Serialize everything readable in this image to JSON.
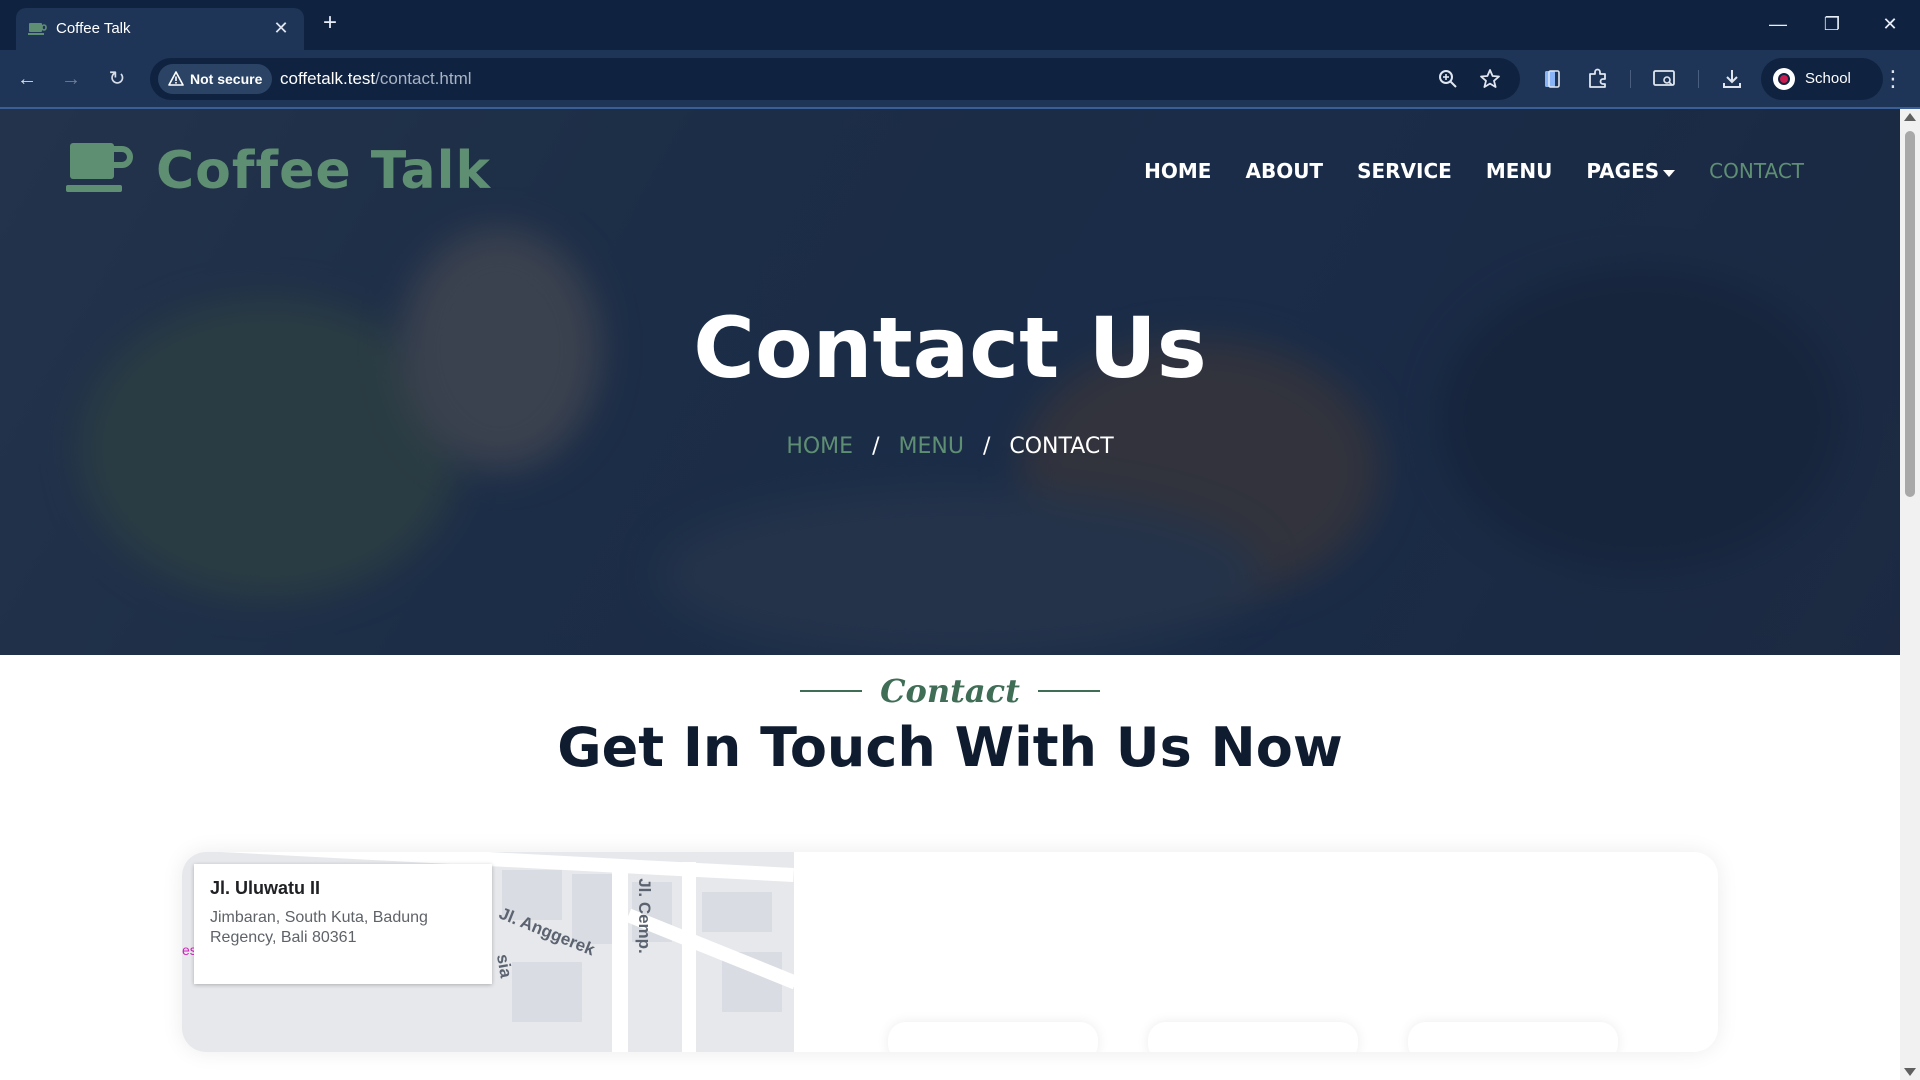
{
  "browser": {
    "tab_title": "Coffee Talk",
    "security_label": "Not secure",
    "url_host": "coffetalk.test",
    "url_path": "/contact.html",
    "profile_label": "School"
  },
  "site": {
    "brand_name": "Coffee Talk",
    "nav": [
      {
        "label": "HOME"
      },
      {
        "label": "ABOUT"
      },
      {
        "label": "SERVICE"
      },
      {
        "label": "MENU"
      },
      {
        "label": "PAGES"
      },
      {
        "label": "CONTACT",
        "active": true
      }
    ]
  },
  "hero": {
    "title": "Contact Us",
    "breadcrumb": [
      "HOME",
      "MENU",
      "CONTACT"
    ],
    "breadcrumb_separator": "/"
  },
  "contact_section": {
    "tag": "Contact",
    "title": "Get In Touch With Us Now"
  },
  "map": {
    "place_name": "Jl. Uluwatu II",
    "address": "Jimbaran, South Kuta, Badung Regency, Bali 80361",
    "street_label_1": "Jl. Anggerek",
    "street_label_2": "Jl. Cemp.",
    "street_label_3": "sia",
    "edge_label": "es"
  },
  "colors": {
    "accent_green": "#5f8f73",
    "dark_navy": "#0f1b2e",
    "chrome_bg": "#0f2240"
  }
}
